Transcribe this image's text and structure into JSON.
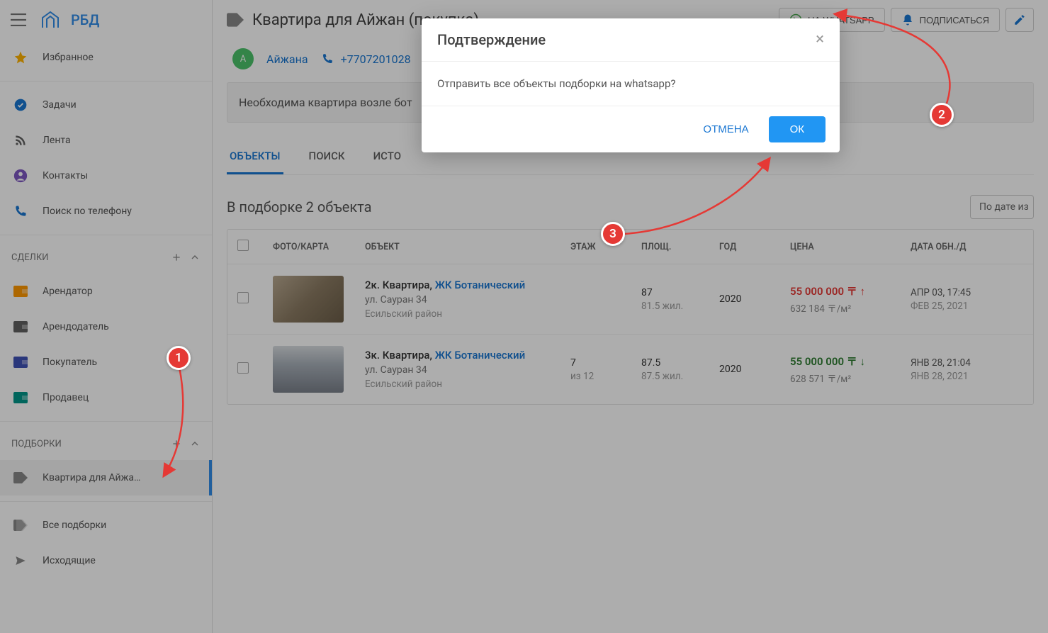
{
  "app": {
    "name": "РБД"
  },
  "sidebar": {
    "favorites": "Избранное",
    "tasks": "Задачи",
    "feed": "Лента",
    "contacts": "Контакты",
    "phone_search": "Поиск по телефону",
    "deals_section": "СДЕЛКИ",
    "deal_items": [
      "Арендатор",
      "Арендодатель",
      "Покупатель",
      "Продавец"
    ],
    "selections_section": "ПОДБОРКИ",
    "selection_active": "Квартира для Айжа…",
    "all_selections": "Все подборки",
    "outgoing": "Исходящие"
  },
  "page": {
    "title": "Квартира для Айжан (покупка)",
    "btn_whatsapp": "НА WHATSAPP",
    "btn_subscribe": "ПОДПИСАТЬСЯ",
    "contact": {
      "initial": "А",
      "name": "Айжана",
      "phone": "+7707201028"
    },
    "description": "Необходима квартира возле бот",
    "tabs": [
      "ОБЪЕКТЫ",
      "ПОИСК",
      "ИСТО"
    ],
    "list_heading": "В подборке 2 объекта",
    "sort_label": "По дате из"
  },
  "table": {
    "headers": {
      "photo": "ФОТО/КАРТА",
      "object": "ОБЪЕКТ",
      "floor": "ЭТАЖ",
      "area": "ПЛОЩ.",
      "year": "ГОД",
      "price": "ЦЕНА",
      "date": "ДАТА ОБН./Д"
    },
    "rows": [
      {
        "title_pre": "2к. Квартира, ",
        "title_jk": "ЖК Ботанический",
        "addr": "ул. Сауран 34",
        "district": "Есильский район",
        "floor": "",
        "floor_sub": "",
        "area": "87",
        "area_sub": "81.5 жил.",
        "year": "2020",
        "price": "55 000 000 〒 ↑",
        "price_sub": "632 184 〒/м²",
        "date1": "АПР 03, 17:45",
        "date2": "ФЕВ 25, 2021"
      },
      {
        "title_pre": "3к. Квартира, ",
        "title_jk": "ЖК Ботанический",
        "addr": "ул. Сауран 34",
        "district": "Есильский район",
        "floor": "7",
        "floor_sub": "из 12",
        "area": "87.5",
        "area_sub": "87.5 жил.",
        "year": "2020",
        "price": "55 000 000 〒 ↓",
        "price_sub": "628 571 〒/м²",
        "date1": "ЯНВ 28, 21:04",
        "date2": "ЯНВ 28, 2021"
      }
    ]
  },
  "modal": {
    "title": "Подтверждение",
    "body": "Отправить все объекты подборки на whatsapp?",
    "cancel": "ОТМЕНА",
    "ok": "ОК"
  },
  "annotations": [
    "1",
    "2",
    "3"
  ]
}
